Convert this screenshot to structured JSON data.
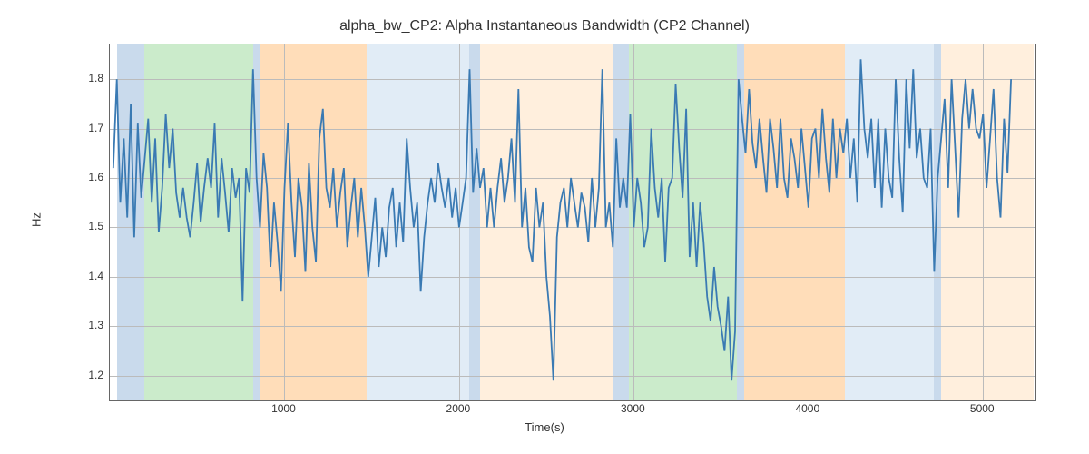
{
  "chart_data": {
    "type": "line",
    "title": "alpha_bw_CP2: Alpha Instantaneous Bandwidth (CP2 Channel)",
    "xlabel": "Time(s)",
    "ylabel": "Hz",
    "xlim": [
      0,
      5300
    ],
    "ylim": [
      1.15,
      1.87
    ],
    "x_ticks": [
      1000,
      2000,
      3000,
      4000,
      5000
    ],
    "y_ticks": [
      1.2,
      1.3,
      1.4,
      1.5,
      1.6,
      1.7,
      1.8
    ],
    "regions": [
      {
        "x0": 40,
        "x1": 200,
        "color": "blue"
      },
      {
        "x0": 200,
        "x1": 820,
        "color": "green"
      },
      {
        "x0": 820,
        "x1": 860,
        "color": "blue"
      },
      {
        "x0": 860,
        "x1": 1470,
        "color": "orange"
      },
      {
        "x0": 1470,
        "x1": 2060,
        "color": "lightblue"
      },
      {
        "x0": 2060,
        "x1": 2120,
        "color": "blue"
      },
      {
        "x0": 2120,
        "x1": 2880,
        "color": "peach"
      },
      {
        "x0": 2880,
        "x1": 2970,
        "color": "blue"
      },
      {
        "x0": 2970,
        "x1": 3590,
        "color": "green"
      },
      {
        "x0": 3590,
        "x1": 3630,
        "color": "blue"
      },
      {
        "x0": 3630,
        "x1": 4210,
        "color": "orange"
      },
      {
        "x0": 4210,
        "x1": 4720,
        "color": "lightblue"
      },
      {
        "x0": 4720,
        "x1": 4760,
        "color": "blue"
      },
      {
        "x0": 4760,
        "x1": 5290,
        "color": "peach"
      }
    ],
    "x": [
      20,
      40,
      60,
      80,
      100,
      120,
      140,
      160,
      180,
      200,
      220,
      240,
      260,
      280,
      300,
      320,
      340,
      360,
      380,
      400,
      420,
      440,
      460,
      480,
      500,
      520,
      540,
      560,
      580,
      600,
      620,
      640,
      660,
      680,
      700,
      720,
      740,
      760,
      780,
      800,
      820,
      840,
      860,
      880,
      900,
      920,
      940,
      960,
      980,
      1000,
      1020,
      1040,
      1060,
      1080,
      1100,
      1120,
      1140,
      1160,
      1180,
      1200,
      1220,
      1240,
      1260,
      1280,
      1300,
      1320,
      1340,
      1360,
      1380,
      1400,
      1420,
      1440,
      1460,
      1480,
      1500,
      1520,
      1540,
      1560,
      1580,
      1600,
      1620,
      1640,
      1660,
      1680,
      1700,
      1720,
      1740,
      1760,
      1780,
      1800,
      1820,
      1840,
      1860,
      1880,
      1900,
      1920,
      1940,
      1960,
      1980,
      2000,
      2020,
      2040,
      2060,
      2080,
      2100,
      2120,
      2140,
      2160,
      2180,
      2200,
      2220,
      2240,
      2260,
      2280,
      2300,
      2320,
      2340,
      2360,
      2380,
      2400,
      2420,
      2440,
      2460,
      2480,
      2500,
      2520,
      2540,
      2560,
      2580,
      2600,
      2620,
      2640,
      2660,
      2680,
      2700,
      2720,
      2740,
      2760,
      2780,
      2800,
      2820,
      2840,
      2860,
      2880,
      2900,
      2920,
      2940,
      2960,
      2980,
      3000,
      3020,
      3040,
      3060,
      3080,
      3100,
      3120,
      3140,
      3160,
      3180,
      3200,
      3220,
      3240,
      3260,
      3280,
      3300,
      3320,
      3340,
      3360,
      3380,
      3400,
      3420,
      3440,
      3460,
      3480,
      3500,
      3520,
      3540,
      3560,
      3580,
      3600,
      3620,
      3640,
      3660,
      3680,
      3700,
      3720,
      3740,
      3760,
      3780,
      3800,
      3820,
      3840,
      3860,
      3880,
      3900,
      3920,
      3940,
      3960,
      3980,
      4000,
      4020,
      4040,
      4060,
      4080,
      4100,
      4120,
      4140,
      4160,
      4180,
      4200,
      4220,
      4240,
      4260,
      4280,
      4300,
      4320,
      4340,
      4360,
      4380,
      4400,
      4420,
      4440,
      4460,
      4480,
      4500,
      4520,
      4540,
      4560,
      4580,
      4600,
      4620,
      4640,
      4660,
      4680,
      4700,
      4720,
      4740,
      4760,
      4780,
      4800,
      4820,
      4840,
      4860,
      4880,
      4900,
      4920,
      4940,
      4960,
      4980,
      5000,
      5020,
      5040,
      5060,
      5080,
      5100,
      5120,
      5140,
      5160,
      5180,
      5200,
      5220,
      5240,
      5260,
      5280
    ],
    "values": [
      1.62,
      1.8,
      1.55,
      1.68,
      1.52,
      1.75,
      1.48,
      1.71,
      1.56,
      1.64,
      1.72,
      1.55,
      1.68,
      1.49,
      1.58,
      1.73,
      1.62,
      1.7,
      1.57,
      1.52,
      1.58,
      1.52,
      1.48,
      1.55,
      1.63,
      1.51,
      1.58,
      1.64,
      1.58,
      1.71,
      1.52,
      1.64,
      1.57,
      1.49,
      1.62,
      1.56,
      1.6,
      1.35,
      1.62,
      1.57,
      1.82,
      1.6,
      1.5,
      1.65,
      1.58,
      1.42,
      1.55,
      1.47,
      1.37,
      1.58,
      1.71,
      1.55,
      1.44,
      1.6,
      1.54,
      1.41,
      1.63,
      1.5,
      1.43,
      1.68,
      1.74,
      1.58,
      1.54,
      1.62,
      1.5,
      1.57,
      1.62,
      1.46,
      1.54,
      1.6,
      1.48,
      1.58,
      1.5,
      1.4,
      1.48,
      1.56,
      1.42,
      1.5,
      1.44,
      1.54,
      1.58,
      1.46,
      1.55,
      1.47,
      1.68,
      1.58,
      1.5,
      1.55,
      1.37,
      1.48,
      1.55,
      1.6,
      1.55,
      1.63,
      1.58,
      1.54,
      1.6,
      1.52,
      1.58,
      1.5,
      1.55,
      1.6,
      1.82,
      1.57,
      1.66,
      1.58,
      1.62,
      1.5,
      1.58,
      1.5,
      1.58,
      1.64,
      1.55,
      1.6,
      1.68,
      1.55,
      1.78,
      1.5,
      1.58,
      1.46,
      1.43,
      1.58,
      1.5,
      1.55,
      1.4,
      1.32,
      1.19,
      1.48,
      1.55,
      1.58,
      1.5,
      1.6,
      1.55,
      1.5,
      1.57,
      1.54,
      1.47,
      1.6,
      1.5,
      1.58,
      1.82,
      1.5,
      1.55,
      1.46,
      1.68,
      1.54,
      1.6,
      1.54,
      1.73,
      1.5,
      1.6,
      1.55,
      1.46,
      1.5,
      1.7,
      1.58,
      1.52,
      1.6,
      1.43,
      1.58,
      1.6,
      1.79,
      1.66,
      1.56,
      1.74,
      1.44,
      1.55,
      1.42,
      1.55,
      1.47,
      1.36,
      1.31,
      1.42,
      1.34,
      1.3,
      1.25,
      1.36,
      1.19,
      1.29,
      1.8,
      1.72,
      1.65,
      1.78,
      1.67,
      1.62,
      1.72,
      1.64,
      1.57,
      1.72,
      1.66,
      1.58,
      1.72,
      1.6,
      1.56,
      1.68,
      1.64,
      1.58,
      1.7,
      1.62,
      1.54,
      1.68,
      1.7,
      1.6,
      1.74,
      1.64,
      1.57,
      1.72,
      1.6,
      1.7,
      1.65,
      1.72,
      1.6,
      1.68,
      1.55,
      1.84,
      1.7,
      1.64,
      1.72,
      1.58,
      1.72,
      1.54,
      1.7,
      1.6,
      1.56,
      1.8,
      1.64,
      1.53,
      1.8,
      1.66,
      1.82,
      1.64,
      1.7,
      1.6,
      1.58,
      1.7,
      1.41,
      1.6,
      1.68,
      1.76,
      1.58,
      1.8,
      1.66,
      1.52,
      1.72,
      1.8,
      1.7,
      1.78,
      1.7,
      1.68,
      1.73,
      1.58,
      1.68,
      1.78,
      1.6,
      1.52,
      1.72,
      1.61,
      1.8
    ]
  }
}
